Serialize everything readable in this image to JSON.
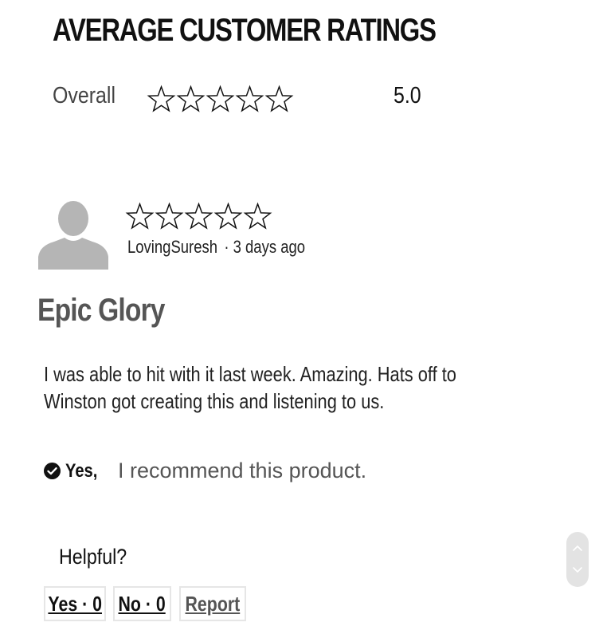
{
  "ratings_section": {
    "title": "AVERAGE CUSTOMER RATINGS",
    "overall_label": "Overall",
    "overall_stars_filled": 0,
    "overall_stars_total": 5,
    "overall_score": "5.0"
  },
  "review": {
    "stars_filled": 0,
    "stars_total": 5,
    "author": "LovingSuresh",
    "separator": "·",
    "time_ago": "3 days ago",
    "title": "Epic Glory",
    "body": "I was able to hit with it last week. Amazing. Hats off to Winston got creating this and listening to us.",
    "recommend_yes": "Yes,",
    "recommend_text": "I recommend this product."
  },
  "helpful": {
    "label": "Helpful?",
    "yes_button": "Yes · 0",
    "no_button": "No · 0",
    "report_button": "Report"
  },
  "icons": {
    "avatar": "user-silhouette-icon",
    "recommend": "check-circle-icon",
    "star": "star-outline-icon",
    "scroll_up": "chevron-up-icon",
    "scroll_down": "chevron-down-icon"
  },
  "colors": {
    "avatar_gray": "#b5b5b5",
    "button_border": "#e6e6e6",
    "scroll_pill": "#e3e3e3"
  }
}
